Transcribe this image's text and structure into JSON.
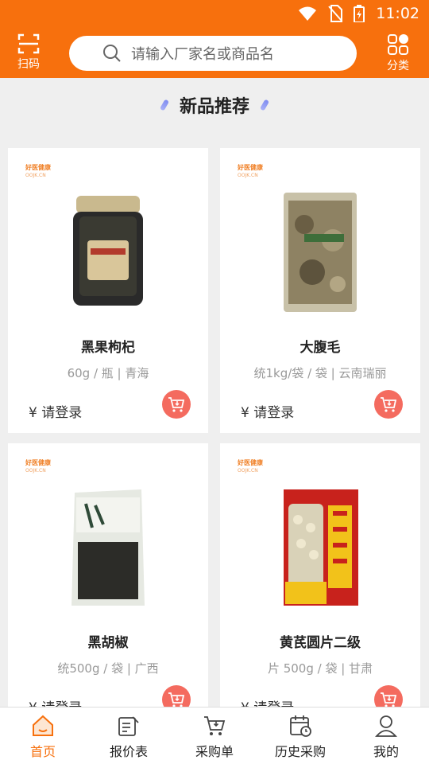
{
  "status_bar": {
    "time": "11:02"
  },
  "header": {
    "scan_label": "扫码",
    "search_placeholder": "请输入厂家名或商品名",
    "category_label": "分类"
  },
  "section": {
    "title": "新品推荐"
  },
  "brand": {
    "name": "好医健康",
    "domain": "OOJK.CN"
  },
  "products": [
    {
      "name": "黑果枸杞",
      "spec": "60g / 瓶 | 青海",
      "price": "¥ 请登录"
    },
    {
      "name": "大腹毛",
      "spec": "统1kg/袋 / 袋 | 云南瑞丽",
      "price": "¥ 请登录"
    },
    {
      "name": "黑胡椒",
      "spec": "统500g / 袋 | 广西",
      "price": "¥ 请登录"
    },
    {
      "name": "黄芪圆片二级",
      "spec": "片 500g / 袋 | 甘肃",
      "price": "¥ 请登录"
    }
  ],
  "nav": [
    {
      "label": "首页",
      "icon": "home-icon",
      "active": true
    },
    {
      "label": "报价表",
      "icon": "quote-list-icon",
      "active": false
    },
    {
      "label": "采购单",
      "icon": "cart-icon",
      "active": false
    },
    {
      "label": "历史采购",
      "icon": "calendar-history-icon",
      "active": false
    },
    {
      "label": "我的",
      "icon": "user-icon",
      "active": false
    }
  ],
  "colors": {
    "brand": "#f7700d",
    "cart_button": "#f46b5f",
    "nav_active": "#f7700d"
  }
}
